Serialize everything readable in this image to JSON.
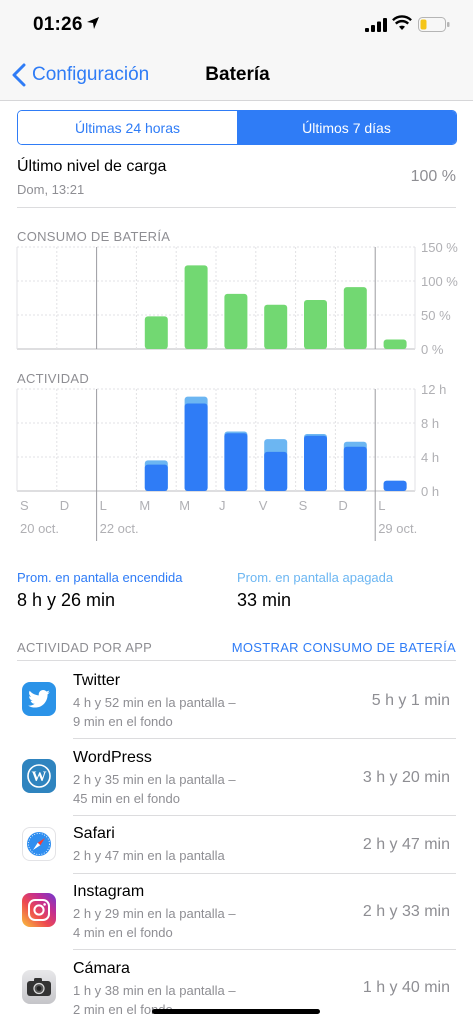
{
  "status_bar": {
    "time": "01:26"
  },
  "nav": {
    "back_label": "Configuración",
    "title": "Batería"
  },
  "segments": {
    "left": "Últimas 24 horas",
    "right": "Últimos 7 días",
    "selected": "right"
  },
  "last_charge": {
    "title": "Último nivel de carga",
    "subtitle": "Dom, 13:21",
    "value": "100 %"
  },
  "battery_section_label": "CONSUMO DE BATERÍA",
  "activity_section_label": "ACTIVIDAD",
  "chart_data": [
    {
      "type": "bar",
      "title": "CONSUMO DE BATERÍA",
      "categories": [
        "S",
        "D",
        "L",
        "M",
        "M",
        "J",
        "V",
        "S",
        "D",
        "L"
      ],
      "values": [
        0,
        0,
        0,
        48,
        123,
        81,
        65,
        72,
        91,
        14
      ],
      "ylim": [
        0,
        150
      ],
      "yticks": [
        "150 %",
        "100 %",
        "50 %",
        "0 %"
      ],
      "color": "#72d872"
    },
    {
      "type": "bar",
      "title": "ACTIVIDAD",
      "categories": [
        "S",
        "D",
        "L",
        "M",
        "M",
        "J",
        "V",
        "S",
        "D",
        "L"
      ],
      "series": [
        {
          "values": [
            0,
            0,
            0,
            3.1,
            10.3,
            6.8,
            4.6,
            6.5,
            5.2,
            1.2
          ],
          "color": "#2f7cf6"
        },
        {
          "values": [
            0,
            0,
            0,
            0.5,
            0.8,
            0.2,
            1.5,
            0.2,
            0.6,
            0
          ],
          "color": "#6cb6f2"
        }
      ],
      "ylim": [
        0,
        12
      ],
      "yticks": [
        "12 h",
        "8 h",
        "4 h",
        "0 h"
      ],
      "date_labels": [
        "20 oct.",
        "22 oct.",
        "29 oct."
      ]
    }
  ],
  "averages": {
    "screen_on_label": "Prom. en pantalla encendida",
    "screen_on_value": "8 h y 26 min",
    "screen_off_label": "Prom. en pantalla apagada",
    "screen_off_value": "33 min"
  },
  "app_activity": {
    "header": "ACTIVIDAD POR APP",
    "toggle": "MOSTRAR CONSUMO DE BATERÍA",
    "apps": [
      {
        "name": "Twitter",
        "line1": "4 h y 52 min en la pantalla –",
        "line2": "9 min en el fondo",
        "total": "5 h y 1 min",
        "icon": "twitter-icon"
      },
      {
        "name": "WordPress",
        "line1": "2 h y 35 min en la pantalla –",
        "line2": "45 min en el fondo",
        "total": "3 h y 20 min",
        "icon": "wordpress-icon"
      },
      {
        "name": "Safari",
        "line1": "2 h y 47 min en la pantalla",
        "line2": "",
        "total": "2 h y 47 min",
        "icon": "safari-icon"
      },
      {
        "name": "Instagram",
        "line1": "2 h y 29 min en la pantalla –",
        "line2": "4 min en el fondo",
        "total": "2 h y 33 min",
        "icon": "instagram-icon"
      },
      {
        "name": "Cámara",
        "line1": "1 h y 38 min en la pantalla –",
        "line2": "2 min en el fondo",
        "total": "1 h y 40 min",
        "icon": "camera-icon"
      }
    ]
  }
}
